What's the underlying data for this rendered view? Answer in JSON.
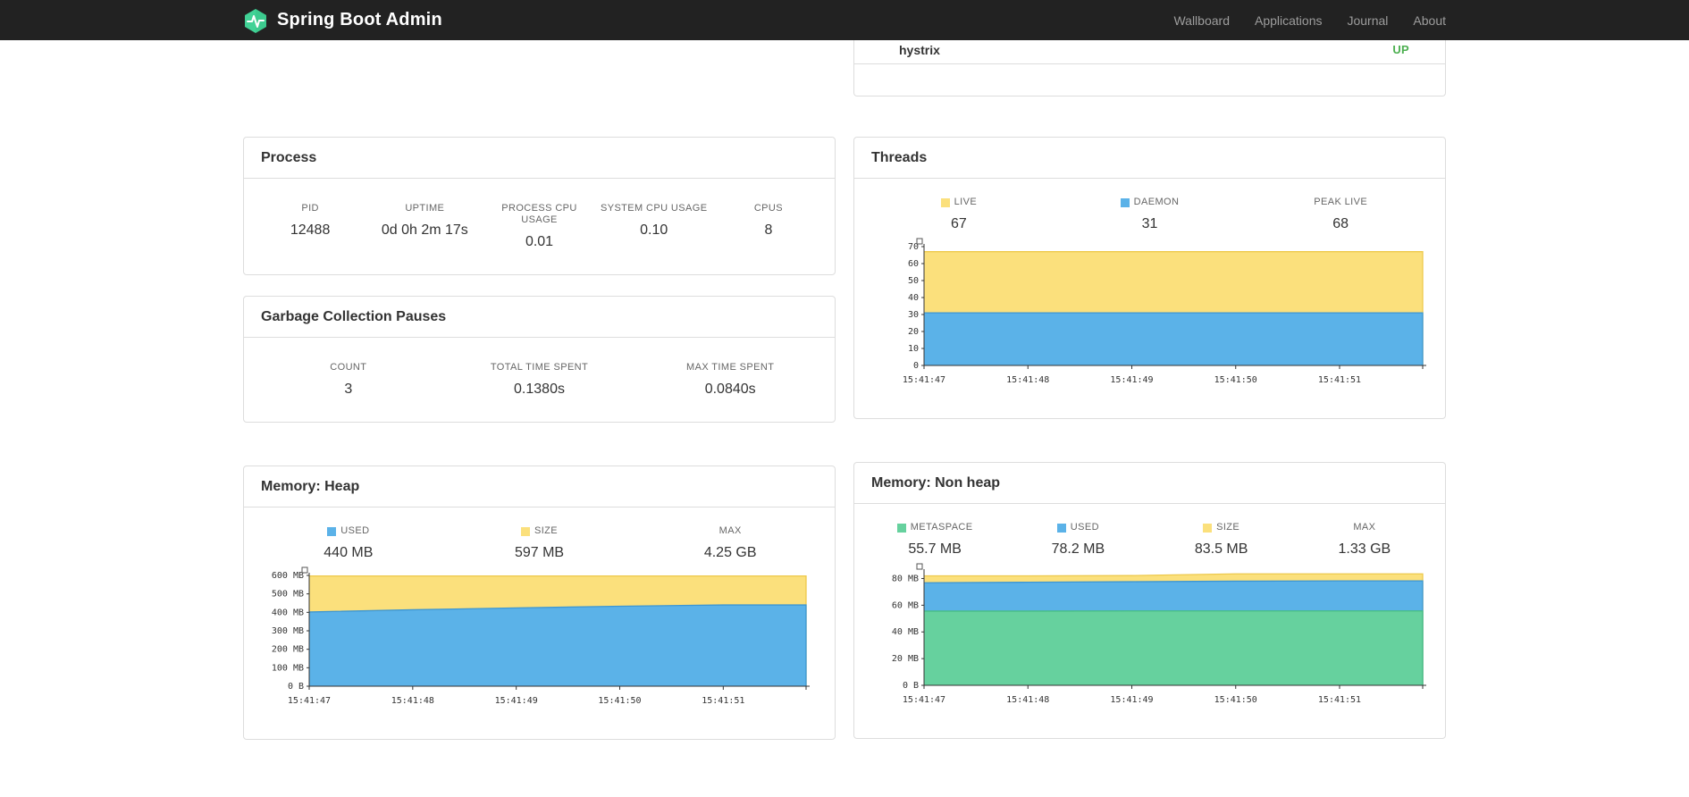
{
  "navbar": {
    "brand": "Spring Boot Admin",
    "items": [
      {
        "label": "Wallboard"
      },
      {
        "label": "Applications"
      },
      {
        "label": "Journal"
      },
      {
        "label": "About"
      }
    ]
  },
  "applications_panel": {
    "rows": [
      {
        "name": "hystrix",
        "status": "UP"
      }
    ]
  },
  "panels": {
    "process": {
      "title": "Process",
      "metrics": [
        {
          "label": "PID",
          "value": "12488"
        },
        {
          "label": "UPTIME",
          "value": "0d 0h 2m 17s"
        },
        {
          "label": "PROCESS CPU USAGE",
          "value": "0.01"
        },
        {
          "label": "SYSTEM CPU USAGE",
          "value": "0.10"
        },
        {
          "label": "CPUS",
          "value": "8"
        }
      ]
    },
    "gc": {
      "title": "Garbage Collection Pauses",
      "metrics": [
        {
          "label": "COUNT",
          "value": "3"
        },
        {
          "label": "TOTAL TIME SPENT",
          "value": "0.1380s"
        },
        {
          "label": "MAX TIME SPENT",
          "value": "0.0840s"
        }
      ]
    },
    "threads": {
      "title": "Threads",
      "metrics": [
        {
          "label": "LIVE",
          "value": "67",
          "swatch": "chart_yellow"
        },
        {
          "label": "DAEMON",
          "value": "31",
          "swatch": "chart_blue"
        },
        {
          "label": "PEAK LIVE",
          "value": "68"
        }
      ]
    },
    "memory_heap": {
      "title": "Memory: Heap",
      "metrics": [
        {
          "label": "USED",
          "value": "440 MB",
          "swatch": "chart_blue"
        },
        {
          "label": "SIZE",
          "value": "597 MB",
          "swatch": "chart_yellow"
        },
        {
          "label": "MAX",
          "value": "4.25 GB"
        }
      ]
    },
    "memory_nonheap": {
      "title": "Memory: Non heap",
      "metrics": [
        {
          "label": "METASPACE",
          "value": "55.7 MB",
          "swatch": "chart_green"
        },
        {
          "label": "USED",
          "value": "78.2 MB",
          "swatch": "chart_blue"
        },
        {
          "label": "SIZE",
          "value": "83.5 MB",
          "swatch": "chart_yellow"
        },
        {
          "label": "MAX",
          "value": "1.33 GB"
        }
      ]
    }
  },
  "colors": {
    "navbar_bg": "#222222",
    "brand_green": "#41d296",
    "status_up": "#4caf50",
    "chart_yellow": "#fbe07c",
    "chart_blue": "#5bb2e8",
    "chart_green": "#66d19e"
  },
  "chart_data": [
    {
      "id": "threads",
      "type": "area",
      "title": "Threads",
      "x": [
        "15:41:47",
        "15:41:48",
        "15:41:49",
        "15:41:50",
        "15:41:51"
      ],
      "ylim": [
        0,
        70
      ],
      "yticks": [
        {
          "v": 0,
          "label": "0"
        },
        {
          "v": 10,
          "label": "10"
        },
        {
          "v": 20,
          "label": "20"
        },
        {
          "v": 30,
          "label": "30"
        },
        {
          "v": 40,
          "label": "40"
        },
        {
          "v": 50,
          "label": "50"
        },
        {
          "v": 60,
          "label": "60"
        },
        {
          "v": 70,
          "label": "70"
        }
      ],
      "series": [
        {
          "name": "LIVE",
          "color": "#fbe07c",
          "line": "#edc94c",
          "values": [
            67,
            67,
            67,
            67,
            67
          ]
        },
        {
          "name": "DAEMON",
          "color": "#5bb2e8",
          "line": "#3d96d2",
          "values": [
            31,
            31,
            31,
            31,
            31
          ]
        }
      ]
    },
    {
      "id": "heap",
      "type": "area",
      "title": "Memory: Heap",
      "x": [
        "15:41:47",
        "15:41:48",
        "15:41:49",
        "15:41:50",
        "15:41:51"
      ],
      "ylim": [
        0,
        600
      ],
      "yticks": [
        {
          "v": 0,
          "label": "0 B"
        },
        {
          "v": 100,
          "label": "100 MB"
        },
        {
          "v": 200,
          "label": "200 MB"
        },
        {
          "v": 300,
          "label": "300 MB"
        },
        {
          "v": 400,
          "label": "400 MB"
        },
        {
          "v": 500,
          "label": "500 MB"
        },
        {
          "v": 600,
          "label": "600 MB"
        }
      ],
      "series": [
        {
          "name": "SIZE",
          "color": "#fbe07c",
          "line": "#edc94c",
          "values": [
            597,
            597,
            597,
            597,
            597
          ]
        },
        {
          "name": "USED",
          "color": "#5bb2e8",
          "line": "#3d96d2",
          "values": [
            402,
            414,
            424,
            433,
            440
          ]
        }
      ]
    },
    {
      "id": "nonheap",
      "type": "area",
      "title": "Memory: Non heap",
      "x": [
        "15:41:47",
        "15:41:48",
        "15:41:49",
        "15:41:50",
        "15:41:51"
      ],
      "ylim": [
        0,
        85
      ],
      "yticks": [
        {
          "v": 0,
          "label": "0 B"
        },
        {
          "v": 20,
          "label": "20 MB"
        },
        {
          "v": 40,
          "label": "40 MB"
        },
        {
          "v": 60,
          "label": "60 MB"
        },
        {
          "v": 80,
          "label": "80 MB"
        }
      ],
      "series": [
        {
          "name": "SIZE",
          "color": "#fbe07c",
          "line": "#edc94c",
          "values": [
            82.0,
            82.0,
            82.2,
            83.5,
            83.5
          ]
        },
        {
          "name": "USED",
          "color": "#5bb2e8",
          "line": "#3d96d2",
          "values": [
            76.8,
            77.2,
            77.6,
            78.0,
            78.2
          ]
        },
        {
          "name": "METASPACE",
          "color": "#66d19e",
          "line": "#46bd84",
          "values": [
            55.6,
            55.6,
            55.7,
            55.7,
            55.7
          ]
        }
      ]
    }
  ]
}
